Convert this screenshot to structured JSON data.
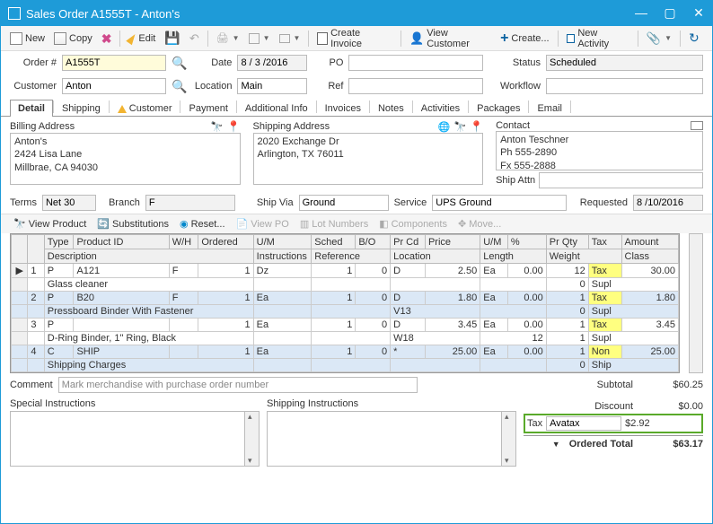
{
  "title": "Sales Order A1555T - Anton's",
  "toolbar": {
    "new": "New",
    "copy": "Copy",
    "edit": "Edit",
    "create_invoice": "Create Invoice",
    "view_customer": "View Customer",
    "create": "Create...",
    "new_activity": "New Activity"
  },
  "form": {
    "order_lbl": "Order #",
    "order_val": "A1555T",
    "date_lbl": "Date",
    "date_val": "8 / 3 /2016",
    "po_lbl": "PO",
    "po_val": "",
    "status_lbl": "Status",
    "status_val": "Scheduled",
    "customer_lbl": "Customer",
    "customer_val": "Anton",
    "location_lbl": "Location",
    "location_val": "Main",
    "ref_lbl": "Ref",
    "ref_val": "",
    "workflow_lbl": "Workflow",
    "workflow_val": ""
  },
  "tabs": [
    "Detail",
    "Shipping",
    "Customer",
    "Payment",
    "Additional Info",
    "Invoices",
    "Notes",
    "Activities",
    "Packages",
    "Email"
  ],
  "addresses": {
    "billing_lbl": "Billing Address",
    "billing_val": "Anton's\n2424 Lisa Lane\nMillbrae, CA 94030",
    "shipping_lbl": "Shipping Address",
    "shipping_val": "2020 Exchange Dr\nArlington, TX 76011",
    "contact_lbl": "Contact",
    "contact_val": "Anton Teschner\nPh 555-2890\nFx 555-2888",
    "ship_attn_lbl": "Ship Attn",
    "ship_attn_val": ""
  },
  "terms": {
    "terms_lbl": "Terms",
    "terms_val": "Net 30",
    "branch_lbl": "Branch",
    "branch_val": "F",
    "ship_via_lbl": "Ship Via",
    "ship_via_val": "Ground",
    "service_lbl": "Service",
    "service_val": "UPS Ground",
    "requested_lbl": "Requested",
    "requested_val": "8 /10/2016"
  },
  "grid_toolbar": {
    "view_product": "View Product",
    "substitutions": "Substitutions",
    "reset": "Reset...",
    "view_po": "View PO",
    "lot_numbers": "Lot Numbers",
    "components": "Components",
    "move": "Move..."
  },
  "columns": [
    "",
    "",
    "Type",
    "Product ID",
    "W/H",
    "Ordered",
    "U/M",
    "Sched",
    "",
    "Instructions",
    "Reference",
    "B/O",
    "Pr Cd",
    "Location",
    "Price",
    "U/M",
    "%",
    "Length",
    "Pr Qty",
    "Weight",
    "Tax",
    "Class",
    "Amount"
  ],
  "headers": {
    "type": "Type",
    "product_id": "Product ID",
    "wh": "W/H",
    "ordered": "Ordered",
    "um": "U/M",
    "sched": "Sched",
    "instructions": "Instructions",
    "reference": "Reference",
    "bo": "B/O",
    "prcd": "Pr Cd",
    "price": "Price",
    "um2": "U/M",
    "location": "Location",
    "pct": "%",
    "length": "Length",
    "prqty": "Pr Qty",
    "weight": "Weight",
    "tax": "Tax",
    "class": "Class",
    "amount": "Amount",
    "description": "Description"
  },
  "rows": [
    {
      "n": "1",
      "type": "P",
      "pid": "A121",
      "wh": "F",
      "ordered": "1",
      "um": "Dz",
      "sched": "1",
      "bo": "0",
      "prcd": "D",
      "price": "2.50",
      "um2": "Ea",
      "pct": "0.00",
      "prqty": "12",
      "tax": "Tax",
      "amount": "30.00",
      "desc": "Glass cleaner",
      "length": "",
      "weight": "0",
      "class": "Supl",
      "loc": ""
    },
    {
      "n": "2",
      "type": "P",
      "pid": "B20",
      "wh": "F",
      "ordered": "1",
      "um": "Ea",
      "sched": "1",
      "bo": "0",
      "prcd": "D",
      "price": "1.80",
      "um2": "Ea",
      "pct": "0.00",
      "prqty": "1",
      "tax": "Tax",
      "amount": "1.80",
      "desc": "Pressboard Binder With Fastener",
      "length": "",
      "weight": "0",
      "class": "Supl",
      "loc": "V13"
    },
    {
      "n": "3",
      "type": "P",
      "pid": "",
      "wh": "",
      "ordered": "1",
      "um": "Ea",
      "sched": "1",
      "bo": "0",
      "prcd": "D",
      "price": "3.45",
      "um2": "Ea",
      "pct": "0.00",
      "prqty": "1",
      "tax": "Tax",
      "amount": "3.45",
      "desc": "D-Ring Binder, 1\" Ring, Black",
      "length": "12",
      "weight": "1",
      "class": "Supl",
      "loc": "W18"
    },
    {
      "n": "4",
      "type": "C",
      "pid": "SHIP",
      "wh": "",
      "ordered": "1",
      "um": "Ea",
      "sched": "1",
      "bo": "0",
      "prcd": "*",
      "price": "25.00",
      "um2": "Ea",
      "pct": "0.00",
      "prqty": "1",
      "tax": "Non",
      "amount": "25.00",
      "desc": "Shipping Charges",
      "length": "",
      "weight": "0",
      "class": "Ship",
      "loc": ""
    }
  ],
  "comment_lbl": "Comment",
  "comment_val": "Mark merchandise with purchase order number",
  "special_instr_lbl": "Special Instructions",
  "shipping_instr_lbl": "Shipping Instructions",
  "totals": {
    "subtotal_lbl": "Subtotal",
    "subtotal": "$60.25",
    "discount_lbl": "Discount",
    "discount": "$0.00",
    "tax_lbl": "Tax",
    "tax_name": "Avatax",
    "tax": "$2.92",
    "ordered_total_lbl": "Ordered Total",
    "ordered_total": "$63.17"
  }
}
